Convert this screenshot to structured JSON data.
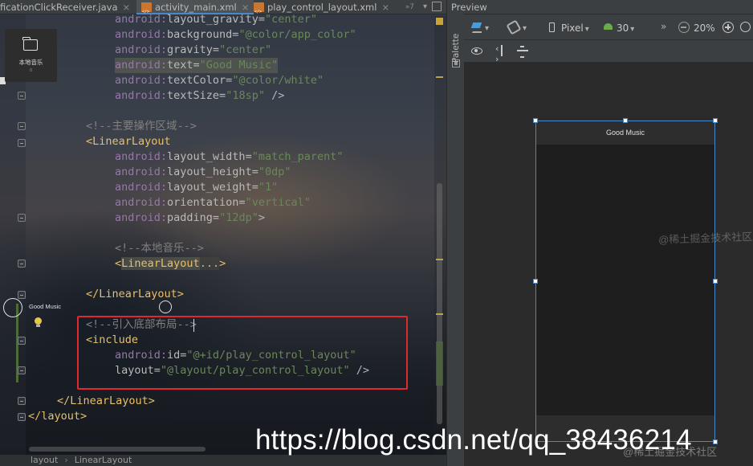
{
  "editor": {
    "tabs": [
      {
        "label": "ficationClickReceiver.java",
        "close": "×"
      },
      {
        "label": "activity_main.xml",
        "close": "×"
      },
      {
        "label": "play_control_layout.xml",
        "close": "×"
      }
    ],
    "tab_overflow": "»7",
    "tab_menu": "▾",
    "breadcrumb": [
      "layout",
      "LinearLayout"
    ],
    "breadcrumb_sep": "›"
  },
  "code": {
    "l1": {
      "ns": "android:",
      "attr": "layout_gravity=",
      "str": "\"center\""
    },
    "l2": {
      "ns": "android:",
      "attr": "background=",
      "str": "\"@color/app_color\""
    },
    "l3": {
      "ns": "android:",
      "attr": "gravity=",
      "str": "\"center\""
    },
    "l4": {
      "ns": "android:",
      "attr": "text=",
      "str": "\"Good Music\""
    },
    "l5": {
      "ns": "android:",
      "attr": "textColor=",
      "str": "\"@color/white\""
    },
    "l6": {
      "ns": "android:",
      "attr": "textSize=",
      "str": "\"18sp\"",
      "end": " />"
    },
    "l7": {
      "comment": "<!--主要操作区域-->"
    },
    "l8": {
      "tag": "<LinearLayout"
    },
    "l9": {
      "ns": "android:",
      "attr": "layout_width=",
      "str": "\"match_parent\""
    },
    "l10": {
      "ns": "android:",
      "attr": "layout_height=",
      "str": "\"0dp\""
    },
    "l11": {
      "ns": "android:",
      "attr": "layout_weight=",
      "str": "\"1\""
    },
    "l12": {
      "ns": "android:",
      "attr": "orientation=",
      "str": "\"vertical\""
    },
    "l13": {
      "ns": "android:",
      "attr": "padding=",
      "str": "\"12dp\"",
      "end": ">"
    },
    "l14": {
      "comment": "<!--本地音乐-->"
    },
    "l15": {
      "tag_open": "<",
      "tag": "LinearLayout",
      "fold": "...",
      "end": ">"
    },
    "l16": {
      "tag": "</LinearLayout>"
    },
    "l17": {
      "comment_a": "<!--引入底部布局",
      "comment_b": "-->"
    },
    "l18": {
      "tag": "<include"
    },
    "l19": {
      "ns": "android:",
      "attr": "id=",
      "str": "\"@+id/play_control_layout\""
    },
    "l20": {
      "attr": "layout=",
      "str": "\"@layout/play_control_layout\"",
      "end": " />"
    },
    "l21": {
      "tag": "</LinearLayout>"
    },
    "l22": {
      "tag": "</layout>"
    }
  },
  "palette": {
    "label": "Palette"
  },
  "preview": {
    "title": "Preview",
    "device": "Pixel",
    "api_level": "30",
    "zoom": "20%",
    "overflow": "»",
    "phone": {
      "title_bar": "Good Music",
      "local_music_label": "本地音乐",
      "local_music_count": "0",
      "bottom_title": "Good Music"
    }
  },
  "watermarks": {
    "csdn_url": "https://blog.csdn.net/qq_38436214",
    "juejin_top": "@稀土掘金技术社区",
    "juejin_bottom": "@稀土掘金技术社区"
  },
  "colors": {
    "highlight_box": "#e0282e",
    "selection": "#4a88c7",
    "xml_namespace": "#9876aa",
    "xml_string": "#6a8759",
    "xml_tag": "#e8bf6a",
    "comment": "#808080"
  }
}
